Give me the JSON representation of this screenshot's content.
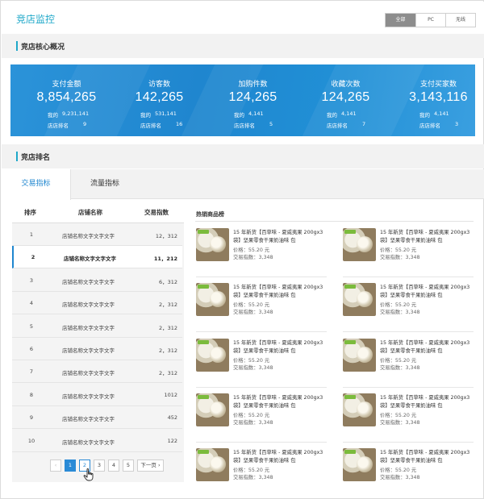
{
  "header": {
    "title": "竞店监控",
    "device_filter": [
      "全部",
      "PC",
      "无线"
    ],
    "device_filter_selected": "全部"
  },
  "core_overview": {
    "title": "竞店核心概况",
    "kpis": [
      {
        "label": "支付金额",
        "value": "8,854,265",
        "mine_label": "我的",
        "mine_value": "9,231,141",
        "rank_label": "店店排名",
        "rank_value": "9"
      },
      {
        "label": "访客数",
        "value": "142,265",
        "mine_label": "我的",
        "mine_value": "531,141",
        "rank_label": "店店排名",
        "rank_value": "16"
      },
      {
        "label": "加购件数",
        "value": "124,265",
        "mine_label": "我的",
        "mine_value": "4,141",
        "rank_label": "店店排名",
        "rank_value": "5"
      },
      {
        "label": "收藏次数",
        "value": "124,265",
        "mine_label": "我的",
        "mine_value": "4,141",
        "rank_label": "店店排名",
        "rank_value": "7"
      },
      {
        "label": "支付买家数",
        "value": "3,143,116",
        "mine_label": "我的",
        "mine_value": "4,141",
        "rank_label": "店店排名",
        "rank_value": "3"
      }
    ]
  },
  "ranking": {
    "title": "竞店排名",
    "tabs": [
      "交易指标",
      "流量指标"
    ],
    "active_tab": "交易指标",
    "columns": {
      "rank": "排序",
      "name": "店铺名称",
      "index": "交易指数",
      "goods": "热销商品榜"
    },
    "rows": [
      {
        "rank": "1",
        "name": "店铺名称文字文字文字",
        "index": "12，312"
      },
      {
        "rank": "2",
        "name": "店铺名称文字文字文字",
        "index": "11，212"
      },
      {
        "rank": "3",
        "name": "店铺名称文字文字文字",
        "index": "6，312"
      },
      {
        "rank": "4",
        "name": "店铺名称文字文字文字",
        "index": "2，312"
      },
      {
        "rank": "5",
        "name": "店铺名称文字文字文字",
        "index": "2，312"
      },
      {
        "rank": "6",
        "name": "店铺名称文字文字文字",
        "index": "2，312"
      },
      {
        "rank": "7",
        "name": "店铺名称文字文字文字",
        "index": "2，312"
      },
      {
        "rank": "8",
        "name": "店铺名称文字文字文字",
        "index": "1012"
      },
      {
        "rank": "9",
        "name": "店铺名称文字文字文字",
        "index": "452"
      },
      {
        "rank": "10",
        "name": "店铺名称文字文字文字",
        "index": "122"
      }
    ],
    "selected_row": "2",
    "pagination": {
      "prev": "‹",
      "pages": [
        "1",
        "2",
        "3",
        "4",
        "5"
      ],
      "current": "1",
      "hovered": "2",
      "next": "下一页 ›"
    },
    "goods": [
      {
        "title": "15 年新货【百草味 - 夏威夷果 200gx3袋】坚果零食干果奶油味 包",
        "price": "价格：55.20 元",
        "trade_index": "交易指数：3,348"
      },
      {
        "title": "15 年新货【百草味 - 夏威夷果 200gx3袋】坚果零食干果奶油味 包",
        "price": "价格：55.20 元",
        "trade_index": "交易指数：3,348"
      },
      {
        "title": "15 年新货【百草味 - 夏威夷果 200gx3袋】坚果零食干果奶油味 包",
        "price": "价格：55.20 元",
        "trade_index": "交易指数：3,348"
      },
      {
        "title": "15 年新货【百草味 - 夏威夷果 200gx3袋】坚果零食干果奶油味 包",
        "price": "价格：55.20 元",
        "trade_index": "交易指数：3,348"
      },
      {
        "title": "15 年新货【百草味 - 夏威夷果 200gx3袋】坚果零食干果奶油味 包",
        "price": "价格：55.20 元",
        "trade_index": "交易指数：3,348"
      },
      {
        "title": "15 年新货【百草味 - 夏威夷果 200gx3袋】坚果零食干果奶油味 包",
        "price": "价格：55.20 元",
        "trade_index": "交易指数：3,348"
      },
      {
        "title": "15 年新货【百草味 - 夏威夷果 200gx3袋】坚果零食干果奶油味 包",
        "price": "价格：55.20 元",
        "trade_index": "交易指数：3,348"
      },
      {
        "title": "15 年新货【百草味 - 夏威夷果 200gx3袋】坚果零食干果奶油味 包",
        "price": "价格：55.20 元",
        "trade_index": "交易指数：3,348"
      },
      {
        "title": "15 年新货【百草味 - 夏威夷果 200gx3袋】坚果零食干果奶油味 包",
        "price": "价格：55.20 元",
        "trade_index": "交易指数：3,348"
      },
      {
        "title": "15 年新货【百草味 - 夏威夷果 200gx3袋】坚果零食干果奶油味 包",
        "price": "价格：55.20 元",
        "trade_index": "交易指数：3,348"
      }
    ]
  },
  "colors": {
    "accent": "#1fa8c9",
    "kpi_panel": "#1f86cf",
    "pager_active": "#2a8ad6"
  }
}
